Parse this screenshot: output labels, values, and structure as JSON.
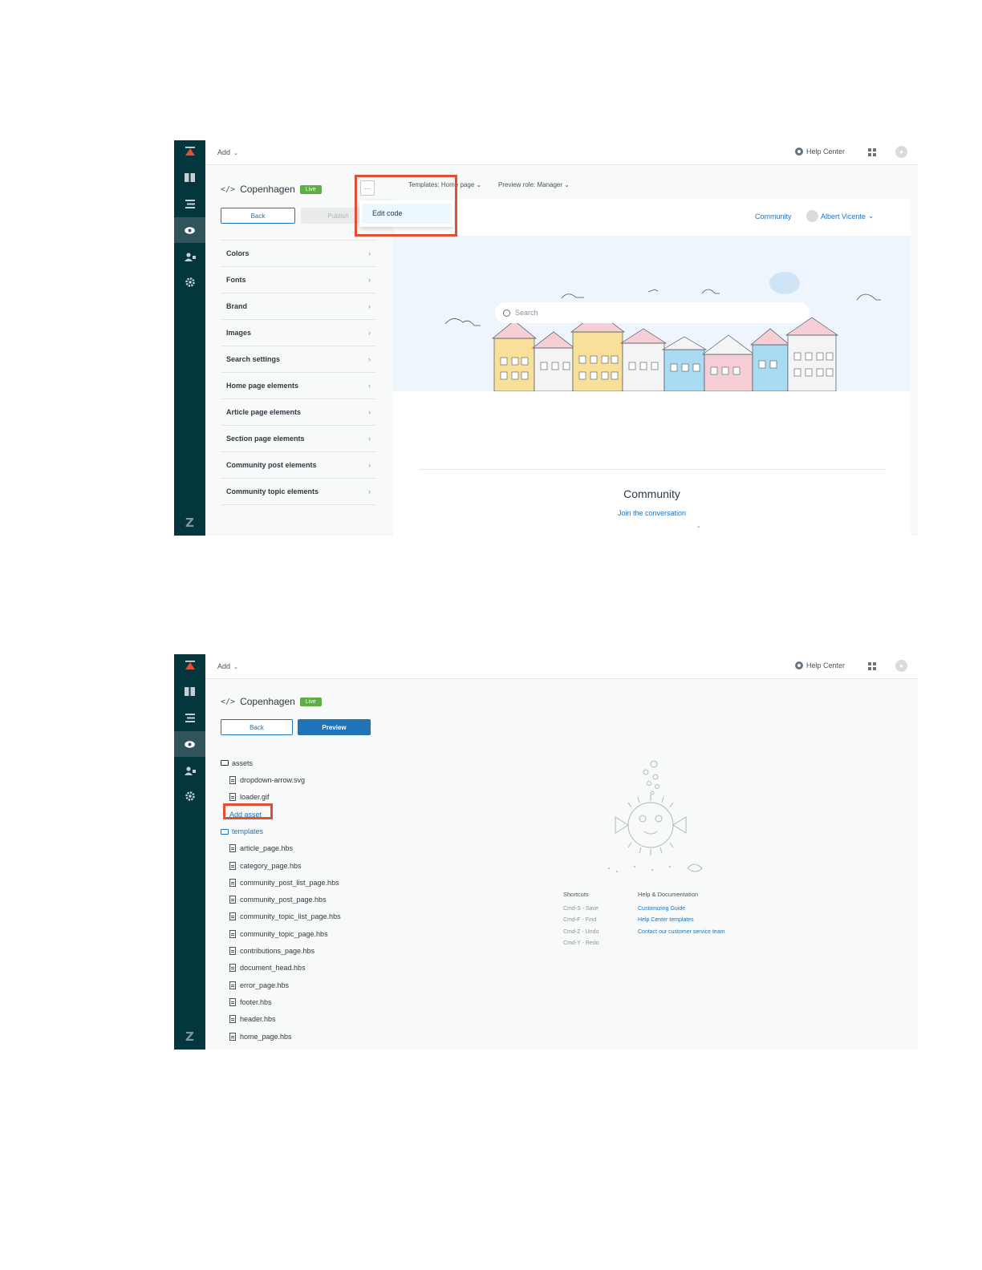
{
  "app": {
    "add_label": "Add",
    "help_center_label": "Help Center",
    "theme_name": "Copenhagen",
    "live_badge": "Live",
    "back_label": "Back"
  },
  "screen1": {
    "publish_label": "Publish",
    "more_label": "...",
    "edit_code_label": "Edit code",
    "templates_selector": "Templates: Home page",
    "preview_role_selector": "Preview role: Manager",
    "settings": [
      {
        "label": "Colors"
      },
      {
        "label": "Fonts"
      },
      {
        "label": "Brand"
      },
      {
        "label": "Images"
      },
      {
        "label": "Search settings"
      },
      {
        "label": "Home page elements"
      },
      {
        "label": "Article page elements"
      },
      {
        "label": "Section page elements"
      },
      {
        "label": "Community post elements"
      },
      {
        "label": "Community topic elements"
      }
    ],
    "preview": {
      "nav_community": "Community",
      "user_name": "Albert Vicente",
      "search_placeholder": "Search",
      "community_title": "Community",
      "community_link": "Join the conversation"
    }
  },
  "screen2": {
    "preview_label": "Preview",
    "assets_folder": "assets",
    "asset_files": [
      "dropdown-arrow.svg",
      "loader.gif"
    ],
    "add_asset_label": "Add asset",
    "templates_folder": "templates",
    "template_files": [
      "article_page.hbs",
      "category_page.hbs",
      "community_post_list_page.hbs",
      "community_post_page.hbs",
      "community_topic_list_page.hbs",
      "community_topic_page.hbs",
      "contributions_page.hbs",
      "document_head.hbs",
      "error_page.hbs",
      "footer.hbs",
      "header.hbs",
      "home_page.hbs"
    ],
    "shortcuts": {
      "title": "Shortcuts",
      "items": [
        "Cmd-S - Save",
        "Cmd-F - Find",
        "Cmd-Z - Undo",
        "Cmd-Y - Redo"
      ]
    },
    "help_docs": {
      "title": "Help & Documentation",
      "links": [
        "Customizing Guide",
        "Help Center templates",
        "Contact our customer service team"
      ]
    }
  },
  "colors": {
    "rail": "#03363d",
    "accent": "#1f73b7",
    "live": "#5eae45",
    "highlight": "#e34f32"
  },
  "icons": {
    "rail": [
      "zendesk-guide-logo",
      "knowledge-base-icon",
      "arrange-content-icon",
      "customize-design-icon",
      "user-permissions-icon",
      "settings-icon",
      "zendesk-icon"
    ],
    "topbar": [
      "lifebuoy-icon",
      "product-grid-icon",
      "user-avatar-icon"
    ]
  }
}
